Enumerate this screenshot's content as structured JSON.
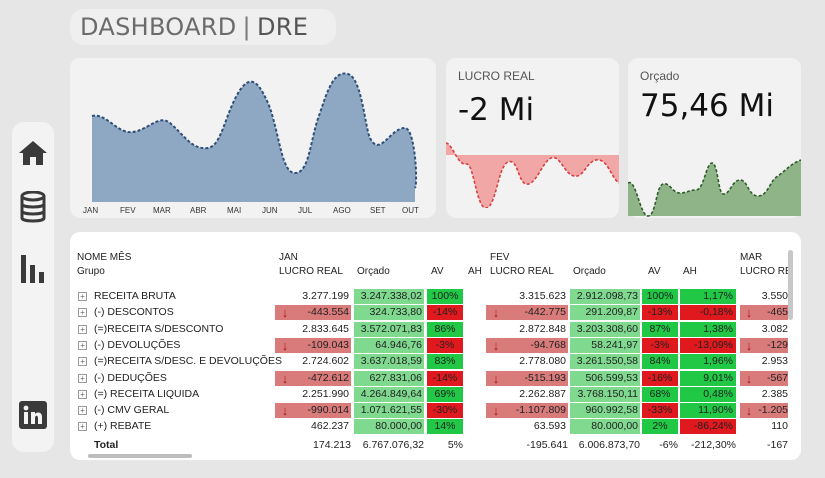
{
  "header": {
    "title": "DASHBOARD",
    "subtitle": "DRE"
  },
  "sidebar": {
    "items": [
      "home-icon",
      "database-icon",
      "bar-chart-icon",
      "linkedin-icon"
    ]
  },
  "area_chart": {
    "months": [
      "JAN",
      "FEV",
      "MAR",
      "ABR",
      "MAI",
      "JUN",
      "JUL",
      "AGO",
      "SET",
      "OUT"
    ]
  },
  "kpi_lucro": {
    "title": "LUCRO REAL",
    "value": "-2 Mi"
  },
  "kpi_orcado": {
    "title": "Orçado",
    "value": "75,46 Mi"
  },
  "colors": {
    "area_fill": "#8ea8c3",
    "area_line": "#2f4f78",
    "loss_fill": "#f2a7a7",
    "loss_line": "#d43f3f",
    "green_fill": "#8fb488",
    "green_line": "#2f5a2a",
    "cell_green": "#21c846",
    "cell_red": "#e0191e",
    "cell_lightgreen": "#7fd98f",
    "cell_darkred": "#d97b7b"
  },
  "table": {
    "col_header_month": "NOME MÊS",
    "col_header_group": "Grupo",
    "months": [
      {
        "name": "JAN",
        "cols": [
          "LUCRO REAL",
          "Orçado",
          "AV",
          "AH"
        ]
      },
      {
        "name": "FEV",
        "cols": [
          "LUCRO REAL",
          "Orçado",
          "AV",
          "AH"
        ]
      },
      {
        "name": "MAR",
        "cols": [
          "LUCRO RE"
        ]
      }
    ],
    "rows": [
      {
        "label": "RECEITA  BRUTA",
        "jan": [
          "3.277.199",
          "3.247.338,02",
          "100%",
          ""
        ],
        "fev": [
          "3.315.623",
          "2.912.098,73",
          "100%",
          "1,17%"
        ],
        "mar": "3.550"
      },
      {
        "label": "(-) DESCONTOS",
        "jan": [
          "-443.554",
          "324.733,80",
          "-14%",
          ""
        ],
        "fev": [
          "-442.775",
          "291.209,87",
          "-13%",
          "-0,18%"
        ],
        "mar": "-465"
      },
      {
        "label": "(=)RECEITA S/DESCONTO",
        "jan": [
          "2.833.645",
          "3.572.071,83",
          "86%",
          ""
        ],
        "fev": [
          "2.872.848",
          "3.203.308,60",
          "87%",
          "1,38%"
        ],
        "mar": "3.082"
      },
      {
        "label": "(-) DEVOLUÇÕES",
        "jan": [
          "-109.043",
          "64.946,76",
          "-3%",
          ""
        ],
        "fev": [
          "-94.768",
          "58.241,97",
          "-3%",
          "-13,09%"
        ],
        "mar": "-129"
      },
      {
        "label": "(=)RECEITA S/DESC. E DEVOLUÇÕES",
        "jan": [
          "2.724.602",
          "3.637.018,59",
          "83%",
          ""
        ],
        "fev": [
          "2.778.080",
          "3.261.550,58",
          "84%",
          "1,96%"
        ],
        "mar": "2.953"
      },
      {
        "label": "(-) DEDUÇÕES",
        "jan": [
          "-472.612",
          "627.831,06",
          "-14%",
          ""
        ],
        "fev": [
          "-515.193",
          "506.599,53",
          "-16%",
          "9,01%"
        ],
        "mar": "-567"
      },
      {
        "label": "(=) RECEITA LIQUIDA",
        "jan": [
          "2.251.990",
          "4.264.849,64",
          "69%",
          ""
        ],
        "fev": [
          "2.262.887",
          "3.768.150,11",
          "68%",
          "0,48%"
        ],
        "mar": "2.385"
      },
      {
        "label": "(-) CMV GERAL",
        "jan": [
          "-990.014",
          "1.071.621,55",
          "-30%",
          ""
        ],
        "fev": [
          "-1.107.809",
          "960.992,58",
          "-33%",
          "11,90%"
        ],
        "mar": "-1.205"
      },
      {
        "label": "(+) REBATE",
        "jan": [
          "462.237",
          "80.000,00",
          "14%",
          ""
        ],
        "fev": [
          "63.593",
          "80.000,00",
          "2%",
          "-86,24%"
        ],
        "mar": "110"
      }
    ],
    "total": {
      "label": "Total",
      "jan": [
        "174.213",
        "6.767.076,32",
        "5%",
        ""
      ],
      "fev": [
        "-195.641",
        "6.006.873,70",
        "-6%",
        "-212,30%"
      ],
      "mar": "-167"
    }
  }
}
